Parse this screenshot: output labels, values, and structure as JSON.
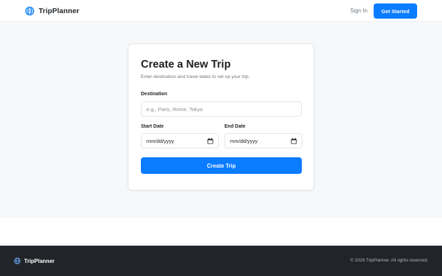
{
  "header": {
    "brand_name": "TripPlanner",
    "brand_icon": "globe-icon",
    "signin_label": "Sign In",
    "get_started_label": "Get Started"
  },
  "form": {
    "title": "Create a New Trip",
    "subtitle": "Enter destination and travel dates to set up your trip.",
    "destination_label": "Destination",
    "destination_placeholder": "e.g., Paris, Rome, Tokyo",
    "destination_value": "",
    "start_date_label": "Start Date",
    "start_date_value": "mm/dd/yyyy",
    "end_date_label": "End Date",
    "end_date_value": "mm/dd/yyyy",
    "submit_label": "Create Trip"
  },
  "footer": {
    "brand_name": "TripPlanner",
    "copyright": "© 2026 TripPlanner. All rights reserved."
  },
  "colors": {
    "accent": "#0a7cff",
    "footer_bg": "#212529",
    "page_bg": "#f6f8fa"
  }
}
